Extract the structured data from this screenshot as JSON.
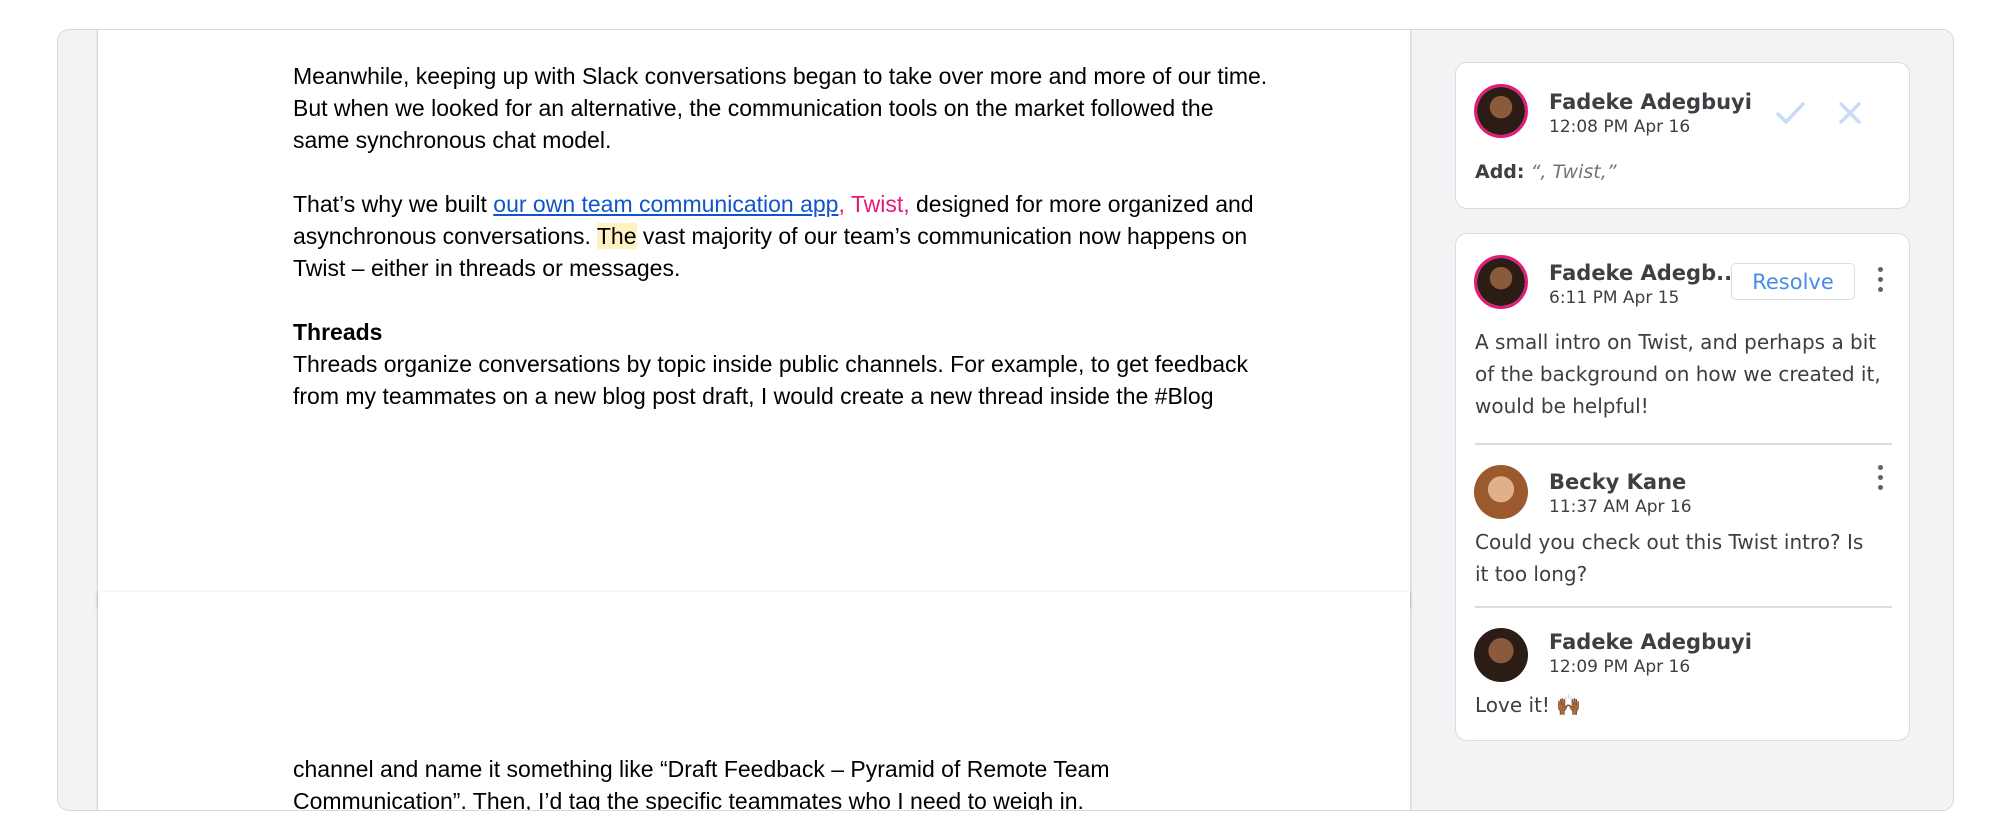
{
  "document": {
    "para1": {
      "line1": "Meanwhile, keeping up with Slack conversations began to take over more and more of our time.",
      "line2": "But when we looked for an alternative, the communication tools on the market followed the",
      "line3": "same synchronous chat model."
    },
    "para2": {
      "before_link": "That’s why we built ",
      "link_text": "our own team communication app",
      "suggested_insert": ", Twist,",
      "after_insert": " designed for more organized and",
      "line2_before": "asynchronous conversations. ",
      "highlighted": "The",
      "line2_after": " vast majority of our team’s communication now happens on",
      "line3": "Twist – either in threads or messages."
    },
    "heading": "Threads",
    "para3": {
      "line1": "Threads organize conversations by topic inside public channels. For example, to get feedback",
      "line2": "from my teammates on a new blog post draft, I would create a new thread inside the #Blog"
    },
    "para4": {
      "line1": "channel and name it something like “Draft Feedback – Pyramid of Remote Team",
      "line2": "Communication”. Then, I’d tag the specific teammates who I need to weigh in."
    }
  },
  "suggestion_card": {
    "author": "Fadeke Adegbuyi",
    "time": "12:08 PM Apr 16",
    "label": "Add:",
    "value": "“, Twist,”",
    "accept_icon": "check-icon",
    "reject_icon": "close-icon"
  },
  "comment_thread": {
    "resolve_label": "Resolve",
    "comments": [
      {
        "author": "Fadeke Adegb...",
        "time": "6:11 PM Apr 15",
        "line1": "A small intro on Twist, and perhaps a bit",
        "line2": "of the background on how we created it,",
        "line3": "would be helpful!"
      },
      {
        "author": "Becky Kane",
        "time": "11:37 AM Apr 16",
        "line1": "Could you check out this Twist intro? Is",
        "line2": "it too long?"
      },
      {
        "author": "Fadeke Adegbuyi",
        "time": "12:09 PM Apr 16",
        "line1": "Love it! 🙌🏾"
      }
    ]
  },
  "colors": {
    "link": "#1155cc",
    "suggestion": "#e8177a",
    "highlight": "#fef2c0",
    "resolve": "#4a8be8"
  }
}
